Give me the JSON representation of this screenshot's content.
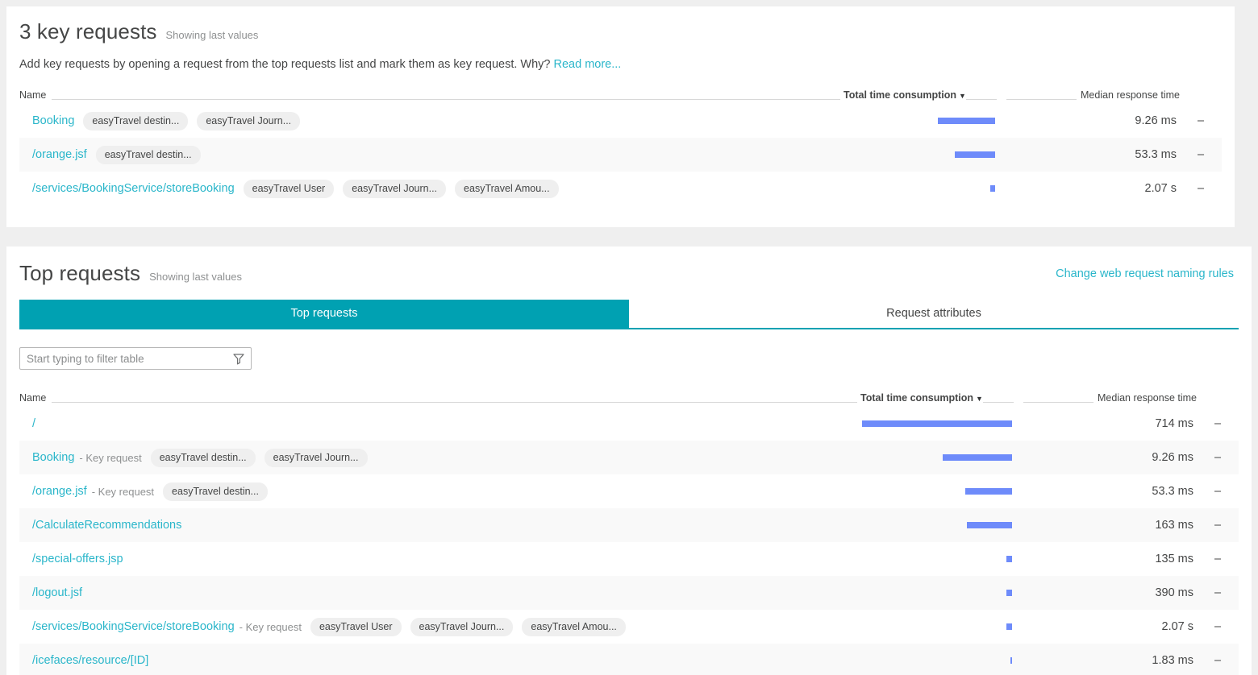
{
  "theme": {
    "page_bg": "#efefef",
    "card_bg": "#ffffff",
    "accent_teal": "#00a1b2",
    "link_blue": "#2ab6ca",
    "bar_blue": "#6e8bfa",
    "alt_row": "#f9f9f9",
    "text": "#454646",
    "muted": "#8e9091"
  },
  "key_requests": {
    "title": "3 key requests",
    "subtitle": "Showing last values",
    "description": "Add key requests by opening a request from the top requests list and mark them as key request. Why?",
    "read_more_label": "Read more...",
    "columns": {
      "name": "Name",
      "total_time": "Total time consumption",
      "sort_caret": "▼",
      "median": "Median response time"
    },
    "rows": [
      {
        "name": "Booking",
        "key_request": false,
        "key_request_label": "",
        "tags": [
          "easyTravel destin...",
          "easyTravel Journ..."
        ],
        "median": "9.26 ms",
        "extra": "–",
        "bar_pct": 38
      },
      {
        "name": "/orange.jsf",
        "key_request": false,
        "key_request_label": "",
        "tags": [
          "easyTravel destin..."
        ],
        "median": "53.3 ms",
        "extra": "–",
        "bar_pct": 27
      },
      {
        "name": "/services/BookingService/storeBooking",
        "key_request": false,
        "key_request_label": "",
        "tags": [
          "easyTravel User",
          "easyTravel Journ...",
          "easyTravel Amou..."
        ],
        "median": "2.07 s",
        "extra": "–",
        "bar_pct": 3
      }
    ]
  },
  "top_requests": {
    "title": "Top requests",
    "subtitle": "Showing last values",
    "change_rules_label": "Change web request naming rules",
    "tabs": [
      {
        "label": "Top requests",
        "active": true
      },
      {
        "label": "Request attributes",
        "active": false
      }
    ],
    "filter": {
      "placeholder": "Start typing to filter table",
      "value": "",
      "icon": "funnel-icon"
    },
    "columns": {
      "name": "Name",
      "total_time": "Total time consumption",
      "sort_caret": "▼",
      "median": "Median response time"
    },
    "rows": [
      {
        "name": "/",
        "key_request": false,
        "key_request_label": "",
        "tags": [],
        "median": "714 ms",
        "extra": "–",
        "bar_pct": 100
      },
      {
        "name": "Booking",
        "key_request": true,
        "key_request_label": "- Key request",
        "tags": [
          "easyTravel destin...",
          "easyTravel Journ..."
        ],
        "median": "9.26 ms",
        "extra": "–",
        "bar_pct": 46
      },
      {
        "name": "/orange.jsf",
        "key_request": true,
        "key_request_label": "- Key request",
        "tags": [
          "easyTravel destin..."
        ],
        "median": "53.3 ms",
        "extra": "–",
        "bar_pct": 31
      },
      {
        "name": "/CalculateRecommendations",
        "key_request": false,
        "key_request_label": "",
        "tags": [],
        "median": "163 ms",
        "extra": "–",
        "bar_pct": 30
      },
      {
        "name": "/special-offers.jsp",
        "key_request": false,
        "key_request_label": "",
        "tags": [],
        "median": "135 ms",
        "extra": "–",
        "bar_pct": 4
      },
      {
        "name": "/logout.jsf",
        "key_request": false,
        "key_request_label": "",
        "tags": [],
        "median": "390 ms",
        "extra": "–",
        "bar_pct": 4
      },
      {
        "name": "/services/BookingService/storeBooking",
        "key_request": true,
        "key_request_label": "- Key request",
        "tags": [
          "easyTravel User",
          "easyTravel Journ...",
          "easyTravel Amou..."
        ],
        "median": "2.07 s",
        "extra": "–",
        "bar_pct": 4
      },
      {
        "name": "/icefaces/resource/[ID]",
        "key_request": false,
        "key_request_label": "",
        "tags": [],
        "median": "1.83 ms",
        "extra": "–",
        "bar_pct": 1
      }
    ]
  }
}
